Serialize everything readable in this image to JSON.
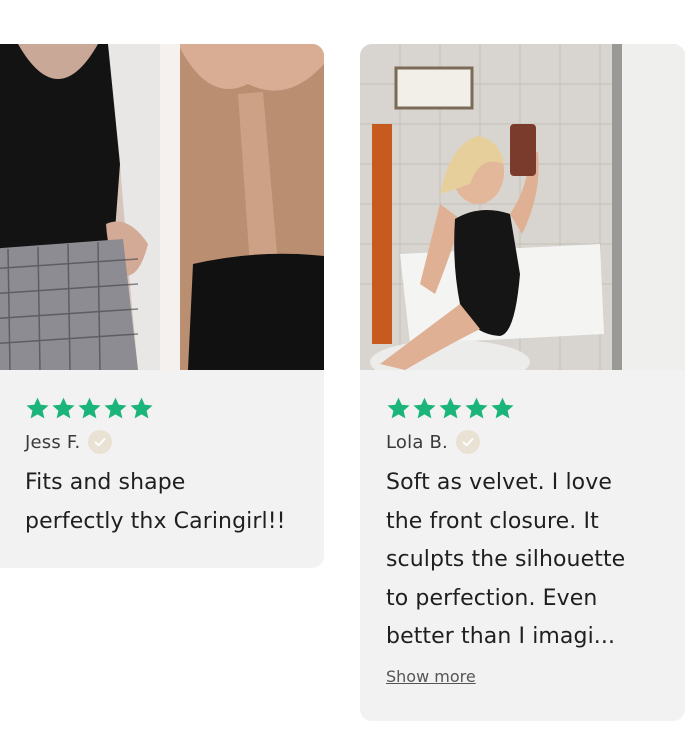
{
  "reviews": [
    {
      "reviewer": "Jess F.",
      "rating": 5,
      "text_line1": "Fits and shape",
      "text_line2": "perfectly thx Caringirl!!"
    },
    {
      "reviewer": "Lola B.",
      "rating": 5,
      "text_lines": [
        "Soft as velvet. I love",
        "the front closure. It",
        "sculpts the silhouette",
        "to perfection. Even",
        "better than I imagi..."
      ],
      "show_more_label": "Show more"
    }
  ],
  "colors": {
    "star": "#1bb47a",
    "card_bg": "#f2f2f2",
    "verified_bg": "#e9e1d4"
  },
  "icons": {
    "star": "star-icon",
    "verified": "verified-check-icon"
  }
}
